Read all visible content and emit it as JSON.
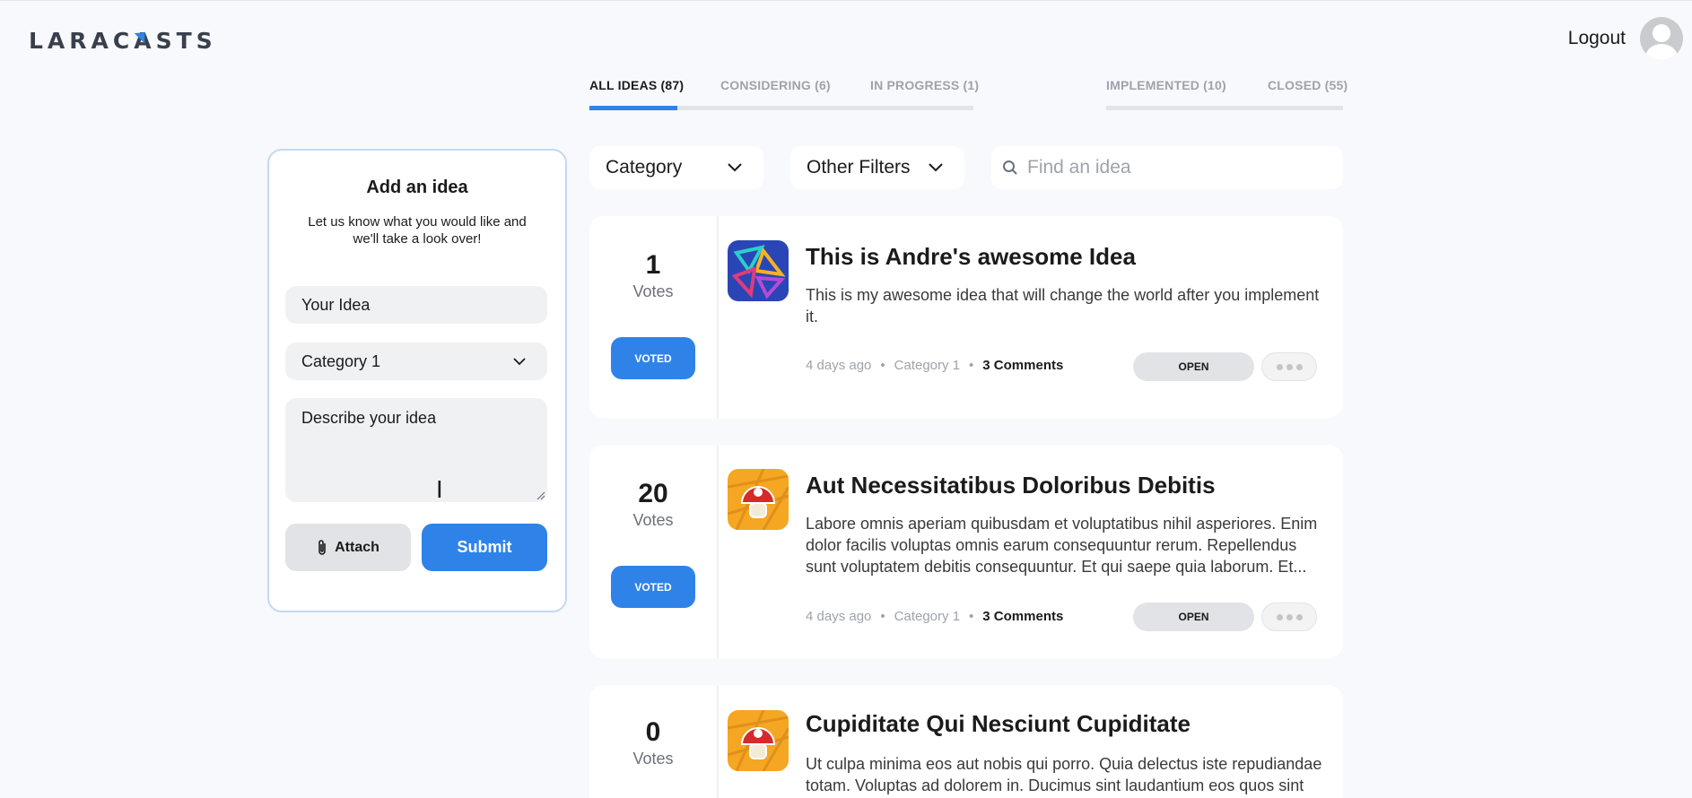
{
  "header": {
    "logo_text": "LARACASTS",
    "logout_label": "Logout"
  },
  "tabs": [
    {
      "label": "ALL IDEAS (87)",
      "active": true
    },
    {
      "label": "CONSIDERING (6)",
      "active": false
    },
    {
      "label": "IN PROGRESS (1)",
      "active": false
    },
    {
      "label": "IMPLEMENTED (10)",
      "active": false
    },
    {
      "label": "CLOSED (55)",
      "active": false
    }
  ],
  "add_idea": {
    "title": "Add an idea",
    "subtitle": "Let us know what you would like and we'll take a look over!",
    "idea_placeholder": "Your Idea",
    "category_value": "Category 1",
    "description_placeholder": "Describe your idea",
    "attach_label": "Attach",
    "submit_label": "Submit"
  },
  "filters": {
    "category_label": "Category",
    "other_label": "Other Filters",
    "search_placeholder": "Find an idea"
  },
  "ideas": [
    {
      "votes": "1",
      "votes_label": "Votes",
      "voted_label": "VOTED",
      "title": "This is Andre's awesome Idea",
      "description": "This is my awesome idea that will change the world after you implement it.",
      "time": "4 days ago",
      "category": "Category 1",
      "comments": "3 Comments",
      "status": "OPEN"
    },
    {
      "votes": "20",
      "votes_label": "Votes",
      "voted_label": "VOTED",
      "title": "Aut Necessitatibus Doloribus Debitis",
      "description": "Labore omnis aperiam quibusdam et voluptatibus nihil asperiores. Enim dolor facilis voluptas omnis earum consequuntur rerum. Repellendus sunt voluptatem debitis consequuntur. Et qui saepe quia laborum. Et...",
      "time": "4 days ago",
      "category": "Category 1",
      "comments": "3 Comments",
      "status": "OPEN"
    },
    {
      "votes": "0",
      "votes_label": "Votes",
      "title": "Cupiditate Qui Nesciunt Cupiditate",
      "description": "Ut culpa minima eos aut nobis qui porro. Quia delectus iste repudiandae totam. Voluptas ad dolorem in. Ducimus sint laudantium eos quos sint"
    }
  ],
  "meta_separator": "•",
  "colors": {
    "accent": "#2f83e8",
    "background": "#f7f9fd",
    "pill": "#e2e3e6"
  },
  "icons": {
    "search": "search-icon",
    "chevron": "chevron-down-icon",
    "attach": "paperclip-icon",
    "more": "ellipsis-icon"
  }
}
